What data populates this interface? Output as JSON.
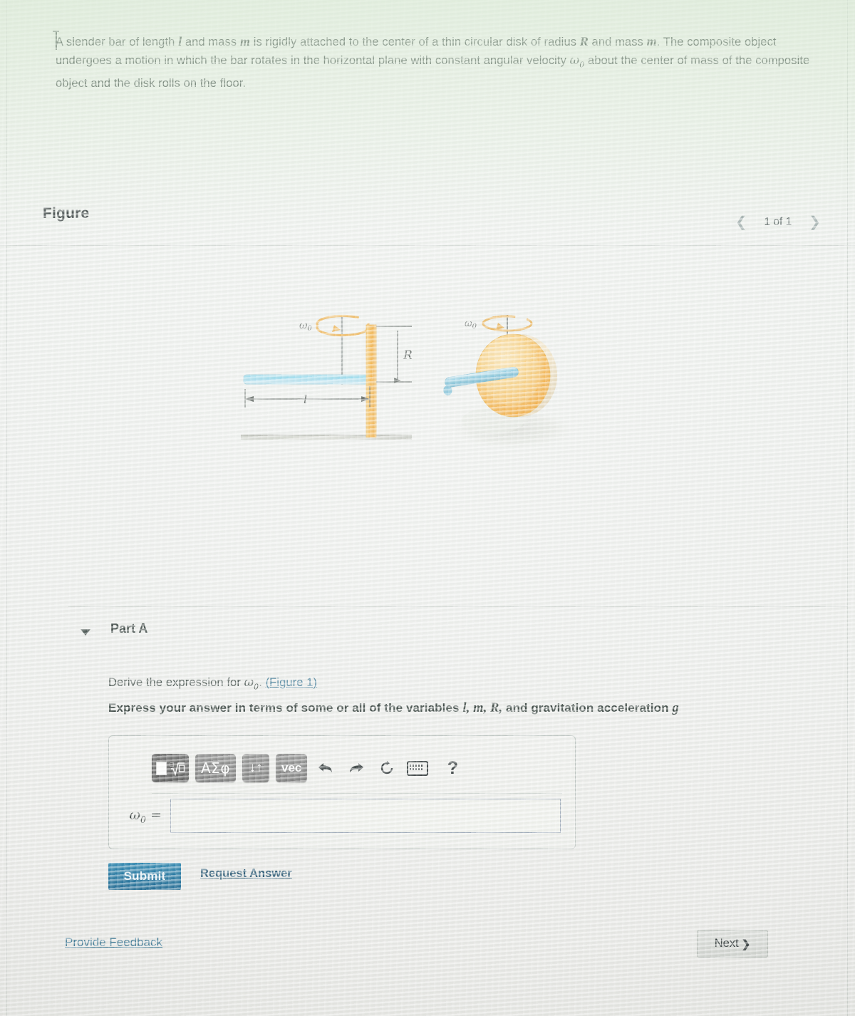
{
  "problem": {
    "text_part1": "A slender bar of length ",
    "var_l": "l",
    "text_part2": " and mass ",
    "var_m1": "m",
    "text_part3": " is rigidly attached to the center of a thin circular disk of radius ",
    "var_R": "R",
    "text_part4": " and mass ",
    "var_m2": "m",
    "text_part5": ". The composite object undergoes a motion in which the bar rotates in the horizontal plane with constant angular velocity ",
    "var_omega": "ω",
    "var_omega_sub": "0",
    "text_part6": " about the center of mass of the composite object and the disk rolls on the floor."
  },
  "figure": {
    "title": "Figure",
    "nav_prev_icon": "chevron-left-icon",
    "nav_next_icon": "chevron-right-icon",
    "counter": "1 of 1",
    "labels": {
      "omega": "ω",
      "omega_sub": "0",
      "radius": "R",
      "length": "l"
    },
    "colors": {
      "bar": "#8fd3e8",
      "bar_dark": "#2f9fc4",
      "disk": "#f4a62a",
      "disk_light": "#fbdf9e",
      "floor": "#b9bcb3",
      "axis": "#707878",
      "arrow": "#e8a63c"
    }
  },
  "part": {
    "toggle_icon": "caret-down-icon",
    "title": "Part A",
    "prompt_prefix": "Derive the expression for ",
    "prompt_omega": "ω",
    "prompt_omega_sub": "0",
    "prompt_suffix": ". ",
    "figure_link": "(Figure 1)",
    "express_prefix": "Express your answer in terms of some or all of the variables ",
    "express_vars": "l, m, R,",
    "express_middle": " and gravitation acceleration ",
    "express_g": "g"
  },
  "toolbar": {
    "template_button": "template-icon",
    "greek_button": "ΑΣφ",
    "arrows_button": "↓↑",
    "vec_button": "vec",
    "undo_icon": "undo-icon",
    "redo_icon": "redo-icon",
    "reset_icon": "reset-icon",
    "keyboard_icon": "keyboard-icon",
    "help_icon": "?"
  },
  "answer": {
    "label_omega": "ω",
    "label_sub": "0",
    "label_equals": " =",
    "value": "",
    "placeholder": ""
  },
  "actions": {
    "submit_label": "Submit",
    "request_answer_label": "Request Answer",
    "provide_feedback_label": "Provide Feedback",
    "next_label": "Next",
    "next_chevron": "❯"
  },
  "colors": {
    "accent_blue": "#1b6f9c",
    "link_blue": "#2f6f8f",
    "page_bg": "#eef0ec",
    "toolbar_btn": "#7a7a7a"
  }
}
